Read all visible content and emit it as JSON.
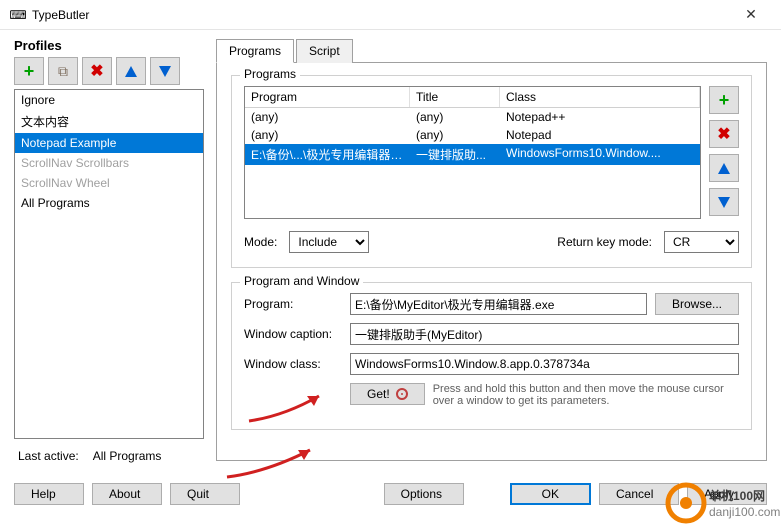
{
  "window": {
    "title": "TypeButler",
    "icon": "⌨"
  },
  "left": {
    "heading": "Profiles",
    "items": [
      "Ignore",
      "文本内容",
      "Notepad Example",
      "ScrollNav Scrollbars",
      "ScrollNav Wheel",
      "All Programs"
    ],
    "selected_index": 2,
    "disabled_indices": [
      3,
      4
    ],
    "last_active_label": "Last active:",
    "last_active_value": "All Programs"
  },
  "tabs": {
    "items": [
      "Programs",
      "Script"
    ],
    "active": 0
  },
  "programs": {
    "group_title": "Programs",
    "columns": [
      "Program",
      "Title",
      "Class"
    ],
    "rows": [
      {
        "program": "(any)",
        "title": "(any)",
        "class": "Notepad++"
      },
      {
        "program": "(any)",
        "title": "(any)",
        "class": "Notepad"
      },
      {
        "program": "E:\\备份\\...\\极光专用编辑器.exe",
        "title": "一键排版助...",
        "class": "WindowsForms10.Window...."
      }
    ],
    "selected_row": 2,
    "mode_label": "Mode:",
    "mode_value": "Include",
    "rkm_label": "Return key mode:",
    "rkm_value": "CR"
  },
  "program_window": {
    "group_title": "Program and Window",
    "program_label": "Program:",
    "program_value": "E:\\备份\\MyEditor\\极光专用编辑器.exe",
    "browse_label": "Browse...",
    "caption_label": "Window caption:",
    "caption_value": "一键排版助手(MyEditor)",
    "class_label": "Window class:",
    "class_value": "WindowsForms10.Window.8.app.0.378734a",
    "get_label": "Get!",
    "get_desc": "Press and hold this button and then move the mouse cursor over a window to get its parameters."
  },
  "footer": {
    "help": "Help",
    "about": "About",
    "quit": "Quit",
    "options": "Options",
    "ok": "OK",
    "cancel": "Cancel",
    "apply": "Apply"
  },
  "watermark": "单机100网\ndanji100.com"
}
